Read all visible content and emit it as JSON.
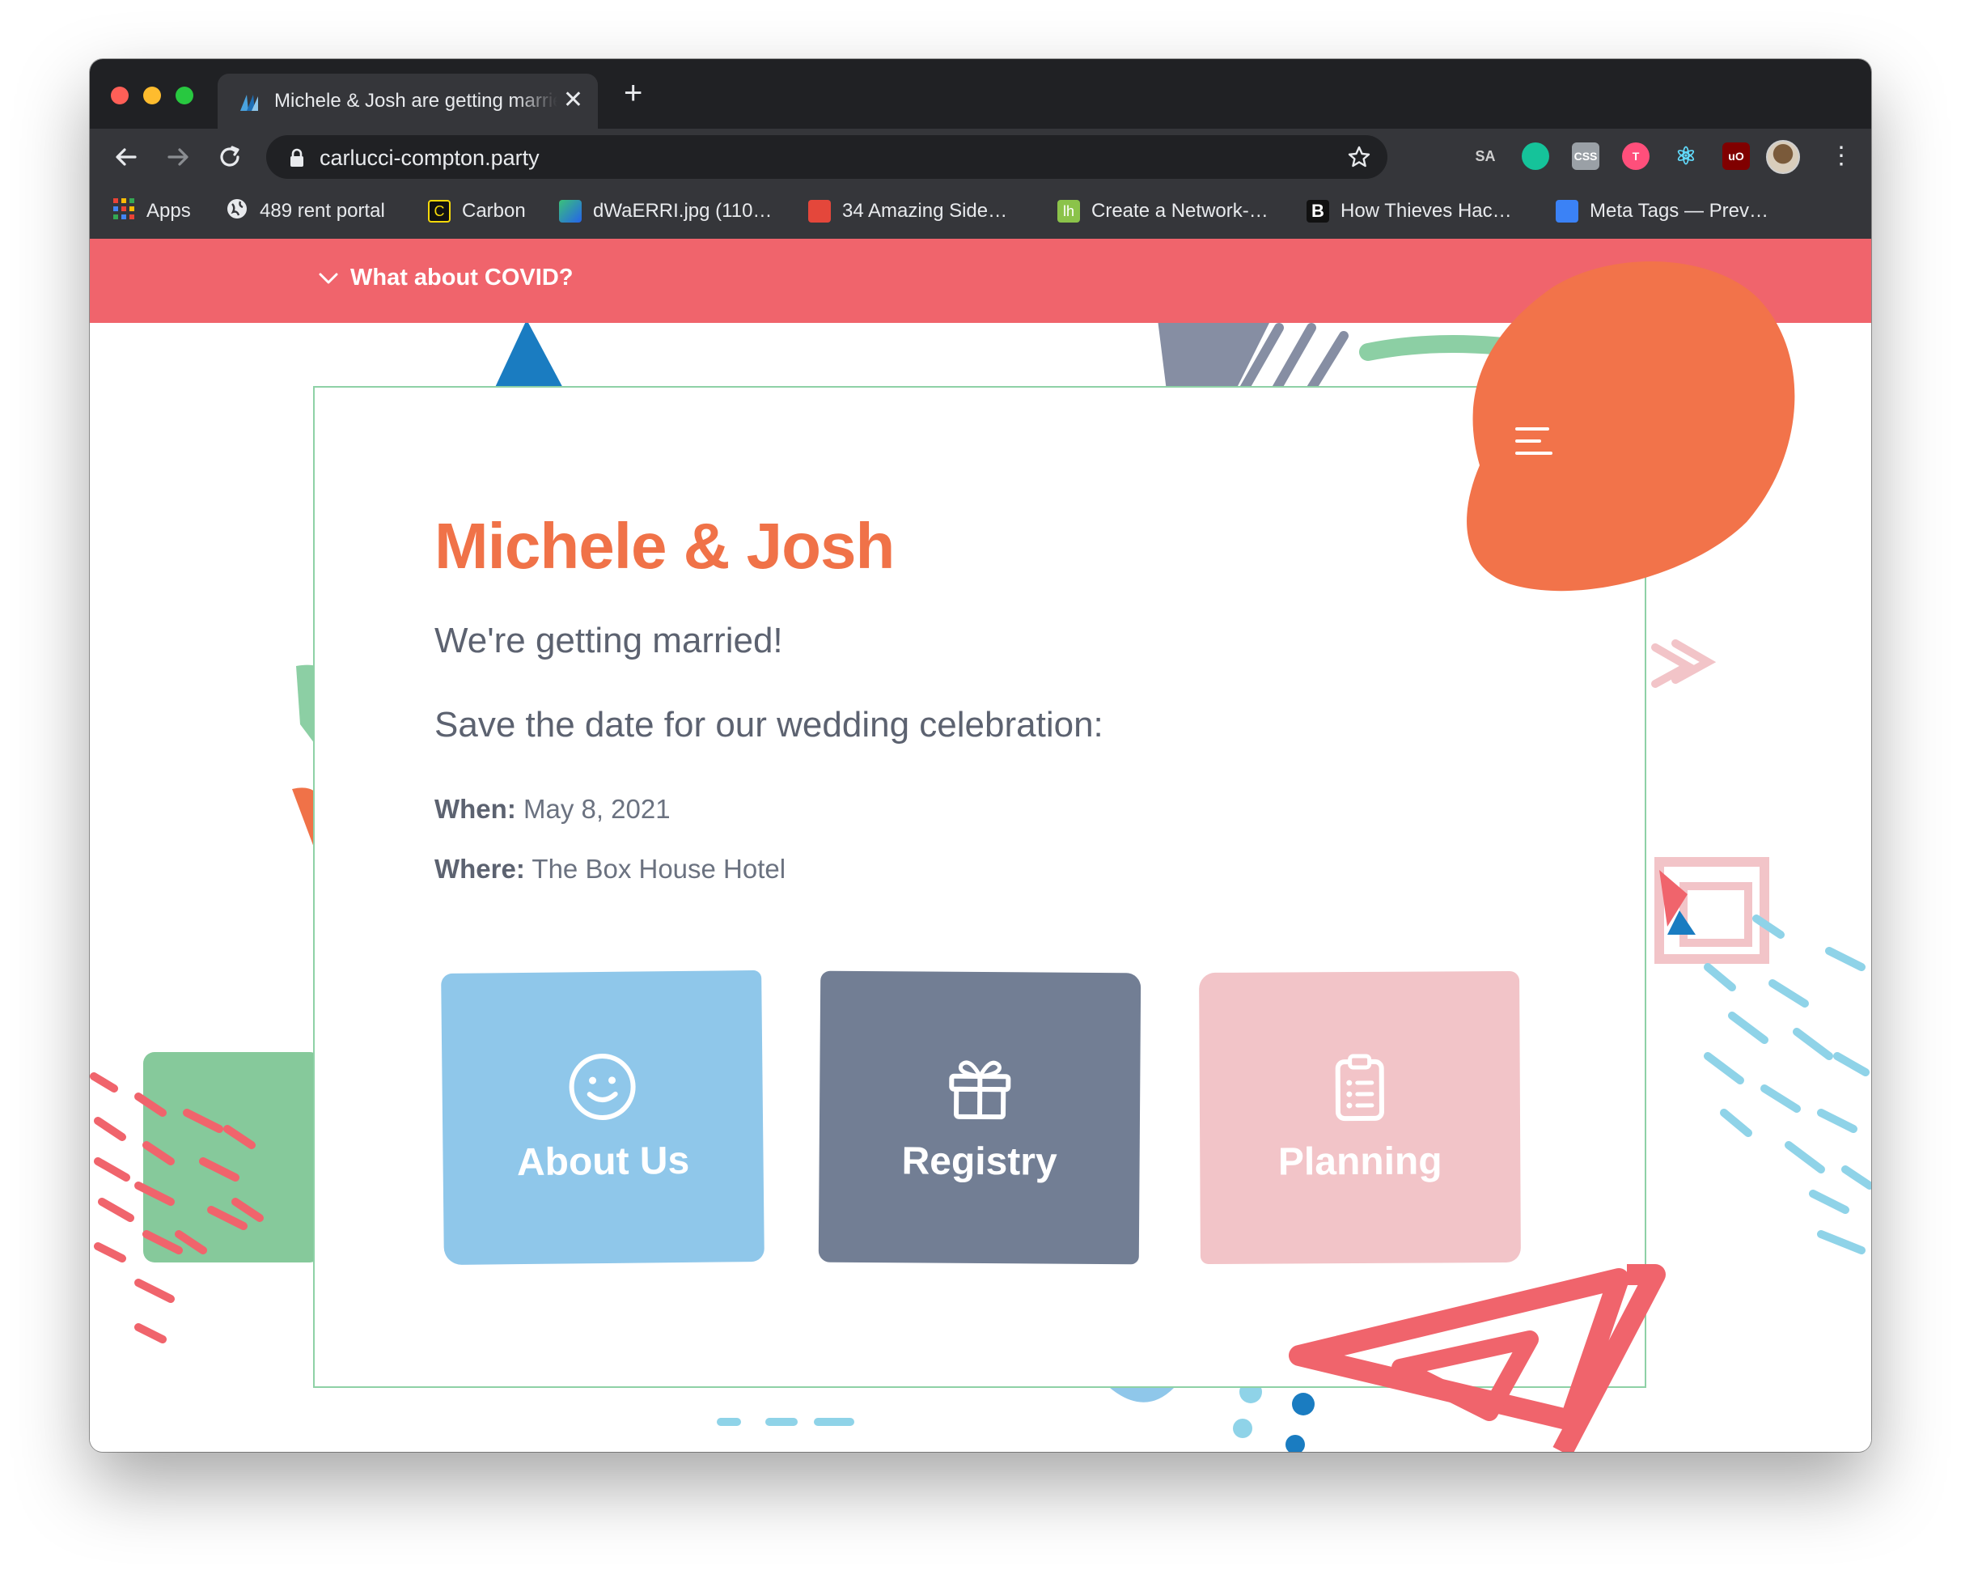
{
  "browser": {
    "tab": {
      "title": "Michele & Josh are getting married",
      "close": "✕"
    },
    "new_tab": "+",
    "url": "carlucci-compton.party",
    "bookmarks": [
      {
        "label": "Apps",
        "color": "#e8710a"
      },
      {
        "label": "489 rent portal",
        "color": "#ffffff"
      },
      {
        "label": "Carbon",
        "color": "#f5d90a"
      },
      {
        "label": "dWaERRI.jpg (110…",
        "color": "#3ac17a"
      },
      {
        "label": "34 Amazing Side…",
        "color": "#e4473b"
      },
      {
        "label": "Create a Network-…",
        "color": "#8bc34a"
      },
      {
        "label": "How Thieves Hac…",
        "color": "#111111"
      },
      {
        "label": "Meta Tags — Prev…",
        "color": "#3b82f6"
      }
    ],
    "extensions": [
      {
        "icon": "sa-icon",
        "color": "#d0d0d0",
        "text": "SA"
      },
      {
        "icon": "grammarly-icon",
        "color": "#15c39a",
        "text": ""
      },
      {
        "icon": "css-icon",
        "color": "#9aa0a6",
        "text": "CSS"
      },
      {
        "icon": "t-icon",
        "color": "#ff4f7b",
        "text": "T"
      },
      {
        "icon": "react-icon",
        "color": "#61dafb",
        "text": "⚛"
      },
      {
        "icon": "ublock-icon",
        "color": "#800000",
        "text": "uO"
      },
      {
        "icon": "puzzle-icon",
        "color": "#e8eaed",
        "text": "✚"
      }
    ]
  },
  "page": {
    "covid_toggle": "What about COVID?",
    "title": "Michele & Josh",
    "tagline": "We're getting married!",
    "save_the_date": "Save the date for our wedding celebration:",
    "when_label": "When:",
    "when_value": "May 8, 2021",
    "where_label": "Where:",
    "where_value": "The Box House Hotel",
    "tiles": [
      {
        "label": "About Us",
        "icon": "smiley-icon"
      },
      {
        "label": "Registry",
        "icon": "gift-icon"
      },
      {
        "label": "Planning",
        "icon": "clipboard-icon"
      }
    ]
  },
  "colors": {
    "covid_bar": "#f0646c",
    "title": "#f07248",
    "about_tile": "#8fc7ea",
    "registry_tile": "#727e94",
    "planning_tile": "#f2c4c8",
    "card_border": "#8ed1a6",
    "blob": "#f2734a"
  }
}
